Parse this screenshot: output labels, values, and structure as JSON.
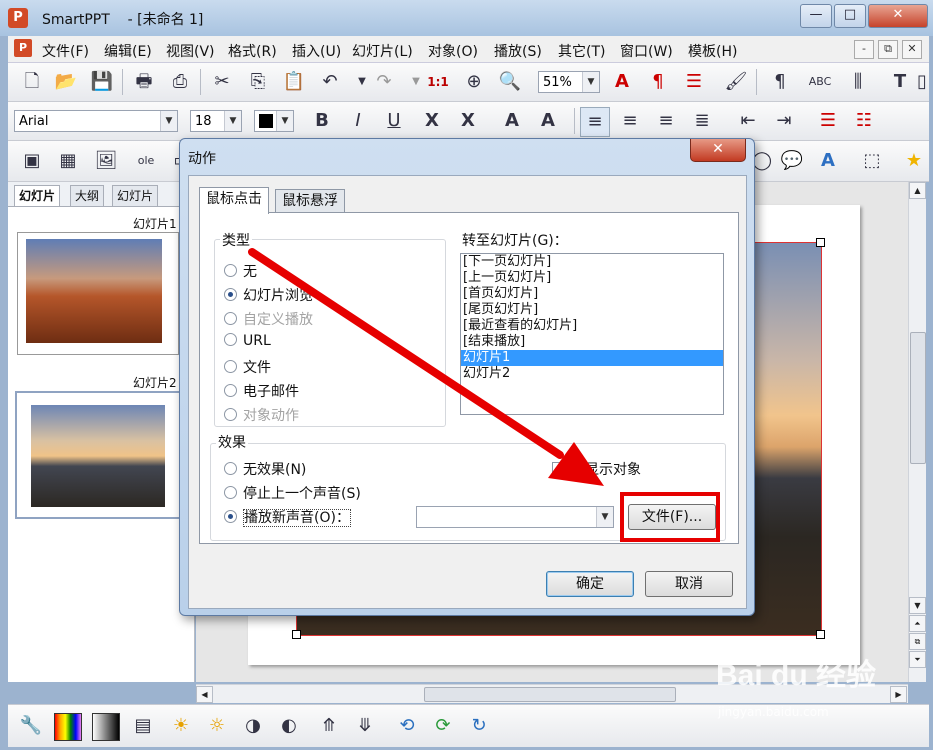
{
  "window": {
    "app_name": "SmartPPT",
    "doc_title": "- [未命名 1]",
    "controls": {
      "minimize": "—",
      "maximize": "□",
      "close": "✕"
    }
  },
  "menubar": {
    "items": [
      "文件(F)",
      "编辑(E)",
      "视图(V)",
      "格式(R)",
      "插入(U)",
      "幻灯片(L)",
      "对象(O)",
      "播放(S)",
      "其它(T)",
      "窗口(W)",
      "模板(H)"
    ],
    "mdi_controls": [
      "-",
      "⧉",
      "✕"
    ]
  },
  "toolbar_standard": {
    "zoom": "51%"
  },
  "toolbar_format": {
    "font_name": "Arial",
    "font_size": "18"
  },
  "left_panel": {
    "tabs": [
      "幻灯片",
      "大纲",
      "幻灯片"
    ],
    "slides": [
      {
        "label": "幻灯片1"
      },
      {
        "label": "幻灯片2"
      }
    ]
  },
  "dialog": {
    "title": "动作",
    "close": "✕",
    "tabs": [
      "鼠标点击",
      "鼠标悬浮"
    ],
    "type_group": {
      "label": "类型",
      "options": [
        {
          "label": "无",
          "selected": false,
          "disabled": false
        },
        {
          "label": "幻灯片浏览",
          "selected": true,
          "disabled": false
        },
        {
          "label": "自定义播放",
          "selected": false,
          "disabled": true
        },
        {
          "label": "URL",
          "selected": false,
          "disabled": false
        },
        {
          "label": "文件",
          "selected": false,
          "disabled": false
        },
        {
          "label": "电子邮件",
          "selected": false,
          "disabled": false
        },
        {
          "label": "对象动作",
          "selected": false,
          "disabled": true
        }
      ]
    },
    "goto_label": "转至幻灯片(G)：",
    "goto_items": [
      "[下一页幻灯片]",
      "[上一页幻灯片]",
      "[首页幻灯片]",
      "[尾页幻灯片]",
      "[最近查看的幻灯片]",
      "[结束播放]",
      "幻灯片1",
      "幻灯片2"
    ],
    "goto_selected_index": 6,
    "effect_group": {
      "label": "效果",
      "options": [
        {
          "label": "无效果(N)",
          "selected": false
        },
        {
          "label": "停止上一个声音(S)",
          "selected": false
        },
        {
          "label": "播放新声音(O)：",
          "selected": true
        }
      ],
      "highlight_label": "高显示对象",
      "sound_value": "",
      "file_button": "文件(F)..."
    },
    "ok_button": "确定",
    "cancel_button": "取消"
  },
  "watermark": {
    "brand": "Bai du 经验",
    "url": "jingyan.baidu.com"
  },
  "colors": {
    "annotation_red": "#e60000",
    "selection_blue": "#3399ff",
    "titlebar": "#b8cfe8"
  }
}
